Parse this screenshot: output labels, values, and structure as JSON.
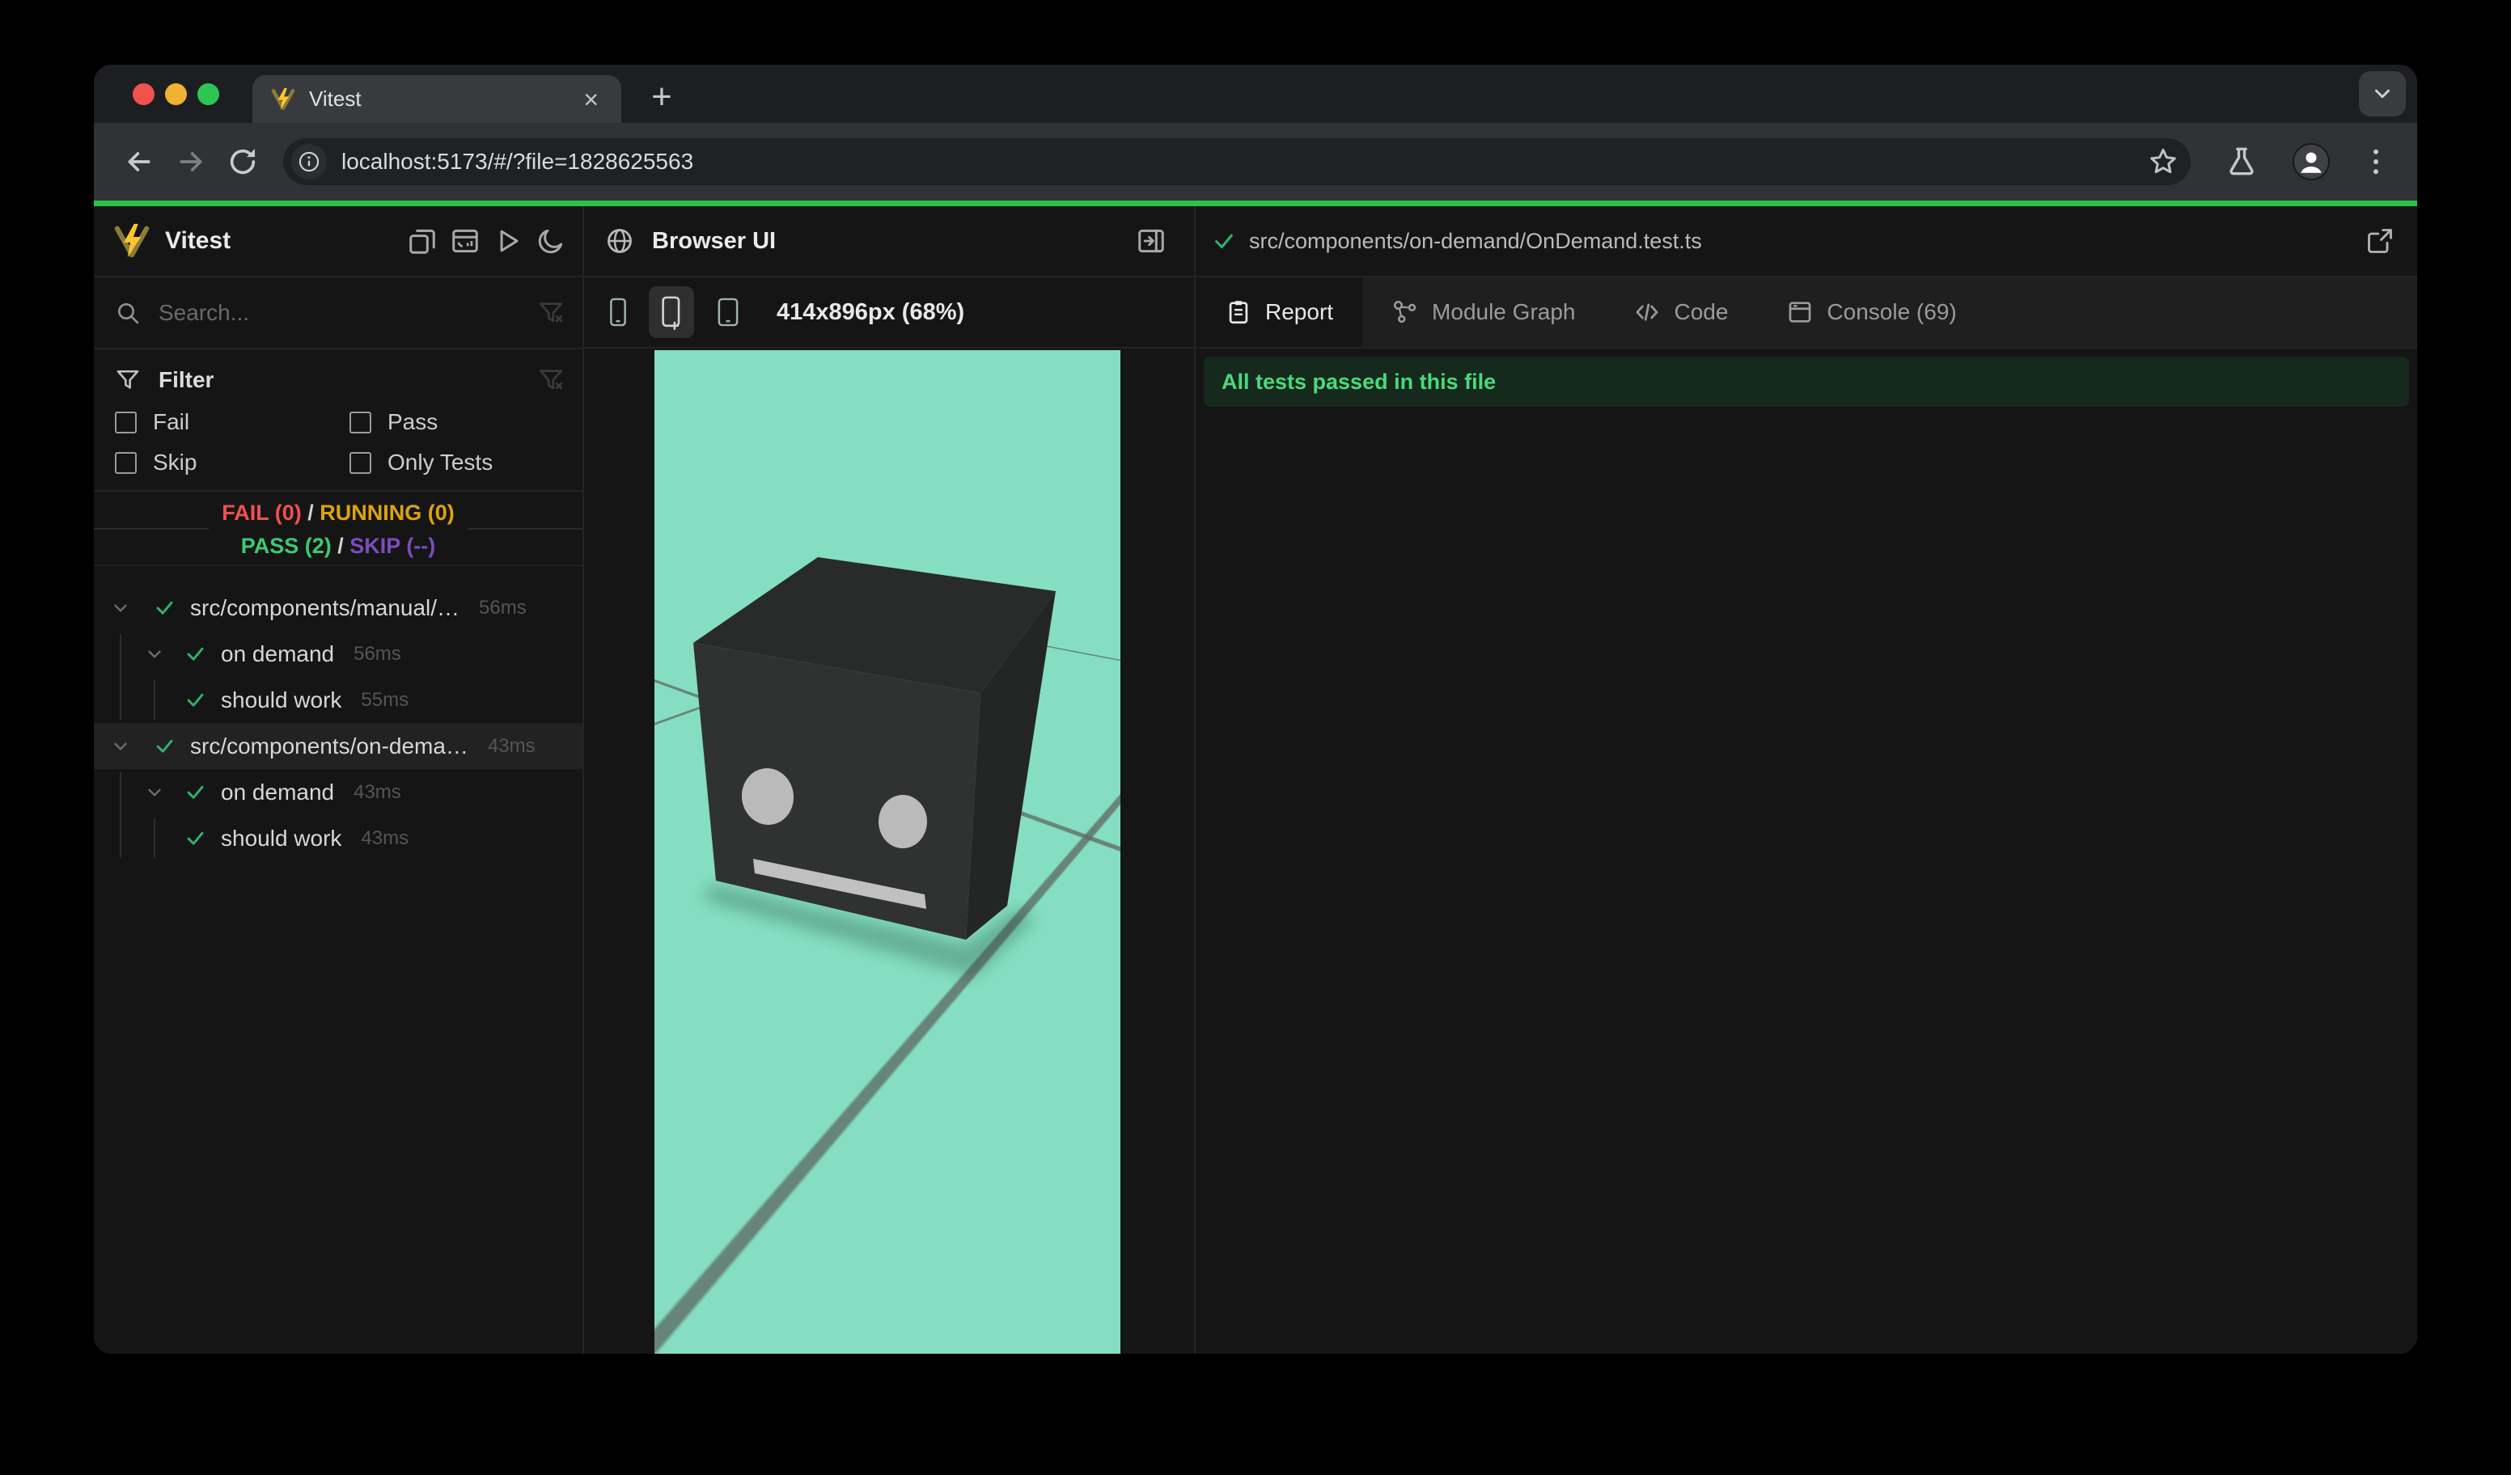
{
  "browser": {
    "tab_title": "Vitest",
    "close_tab": "×",
    "new_tab": "+",
    "url": "localhost:5173/#/?file=1828625563"
  },
  "sidebar": {
    "app_title": "Vitest",
    "search_placeholder": "Search...",
    "filter": {
      "title": "Filter",
      "options": [
        "Fail",
        "Pass",
        "Skip",
        "Only Tests"
      ]
    },
    "summary": {
      "fail_label": "FAIL (0)",
      "running_label": "RUNNING (0)",
      "pass_label": "PASS (2)",
      "skip_label": "SKIP (--)",
      "sep": "/"
    },
    "tree": [
      {
        "label": "src/components/manual/…",
        "duration": "56ms",
        "level": 0,
        "status": "pass",
        "selected": false
      },
      {
        "label": "on demand",
        "duration": "56ms",
        "level": 1,
        "status": "pass",
        "selected": false
      },
      {
        "label": "should work",
        "duration": "55ms",
        "level": 2,
        "status": "pass",
        "selected": false
      },
      {
        "label": "src/components/on-dema…",
        "duration": "43ms",
        "level": 0,
        "status": "pass",
        "selected": true
      },
      {
        "label": "on demand",
        "duration": "43ms",
        "level": 1,
        "status": "pass",
        "selected": false
      },
      {
        "label": "should work",
        "duration": "43ms",
        "level": 2,
        "status": "pass",
        "selected": false
      }
    ]
  },
  "preview": {
    "title": "Browser UI",
    "viewport_label": "414x896px (68%)",
    "scene_background": "#85dec1"
  },
  "report": {
    "file_path": "src/components/on-demand/OnDemand.test.ts",
    "tabs": [
      {
        "label": "Report",
        "active": true
      },
      {
        "label": "Module Graph",
        "active": false
      },
      {
        "label": "Code",
        "active": false
      },
      {
        "label": "Console (69)",
        "active": false
      }
    ],
    "banner": "All tests passed in this file"
  },
  "colors": {
    "accent_green": "#26c547",
    "pass_green": "#3fc873",
    "fail_red": "#f05151",
    "running_yellow": "#dda40a",
    "skip_purple": "#7c4dbf",
    "mint_viewport": "#85dec1",
    "banner_bg": "#15291d",
    "banner_text": "#49d97c"
  }
}
